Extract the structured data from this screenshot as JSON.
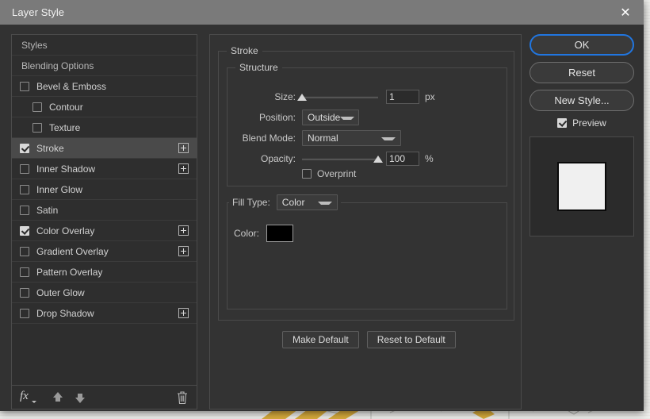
{
  "window": {
    "title": "Layer Style",
    "close_icon": "close-icon"
  },
  "styles_panel": {
    "rows": [
      {
        "label": "Styles",
        "type": "header",
        "checked": null,
        "indent": 0,
        "plus": false
      },
      {
        "label": "Blending Options",
        "type": "header",
        "checked": null,
        "indent": 0,
        "plus": false
      },
      {
        "label": "Bevel & Emboss",
        "type": "effect",
        "checked": false,
        "indent": 0,
        "plus": false
      },
      {
        "label": "Contour",
        "type": "effect",
        "checked": false,
        "indent": 1,
        "plus": false
      },
      {
        "label": "Texture",
        "type": "effect",
        "checked": false,
        "indent": 1,
        "plus": false
      },
      {
        "label": "Stroke",
        "type": "effect",
        "checked": true,
        "indent": 0,
        "plus": true,
        "selected": true
      },
      {
        "label": "Inner Shadow",
        "type": "effect",
        "checked": false,
        "indent": 0,
        "plus": true
      },
      {
        "label": "Inner Glow",
        "type": "effect",
        "checked": false,
        "indent": 0,
        "plus": false
      },
      {
        "label": "Satin",
        "type": "effect",
        "checked": false,
        "indent": 0,
        "plus": false
      },
      {
        "label": "Color Overlay",
        "type": "effect",
        "checked": true,
        "indent": 0,
        "plus": true
      },
      {
        "label": "Gradient Overlay",
        "type": "effect",
        "checked": false,
        "indent": 0,
        "plus": true
      },
      {
        "label": "Pattern Overlay",
        "type": "effect",
        "checked": false,
        "indent": 0,
        "plus": false
      },
      {
        "label": "Outer Glow",
        "type": "effect",
        "checked": false,
        "indent": 0,
        "plus": false
      },
      {
        "label": "Drop Shadow",
        "type": "effect",
        "checked": false,
        "indent": 0,
        "plus": true
      }
    ],
    "footer": {
      "fx_label": "fx",
      "fx_icon": "fx-menu-icon",
      "move_up_icon": "arrow-up-icon",
      "move_down_icon": "arrow-down-icon",
      "delete_icon": "trash-icon"
    }
  },
  "options_panel": {
    "group_title": "Stroke",
    "structure": {
      "legend": "Structure",
      "size": {
        "label": "Size:",
        "value": "1",
        "unit": "px",
        "slider_percent": 0
      },
      "position": {
        "label": "Position:",
        "value": "Outside"
      },
      "blend_mode": {
        "label": "Blend Mode:",
        "value": "Normal"
      },
      "opacity": {
        "label": "Opacity:",
        "value": "100",
        "unit": "%",
        "slider_percent": 100
      },
      "overprint": {
        "label": "Overprint",
        "checked": false
      }
    },
    "fill_type": {
      "label": "Fill Type:",
      "value": "Color",
      "color": {
        "label": "Color:",
        "value": "#000000"
      }
    },
    "buttons": {
      "make_default": "Make Default",
      "reset_to_default": "Reset to Default"
    }
  },
  "action_panel": {
    "ok": "OK",
    "reset": "Reset",
    "new_style": "New Style...",
    "preview": {
      "label": "Preview",
      "checked": true
    },
    "thumbnail": {
      "fill_color": "#f0f0f0",
      "stroke_color": "#0a0a0a"
    }
  },
  "theme": {
    "accent": "#2176e0",
    "dialog_bg": "#323232",
    "titlebar_bg": "#7a7a7a",
    "panel_bg": "#2e2e2e",
    "text": "#d2d2d2"
  }
}
